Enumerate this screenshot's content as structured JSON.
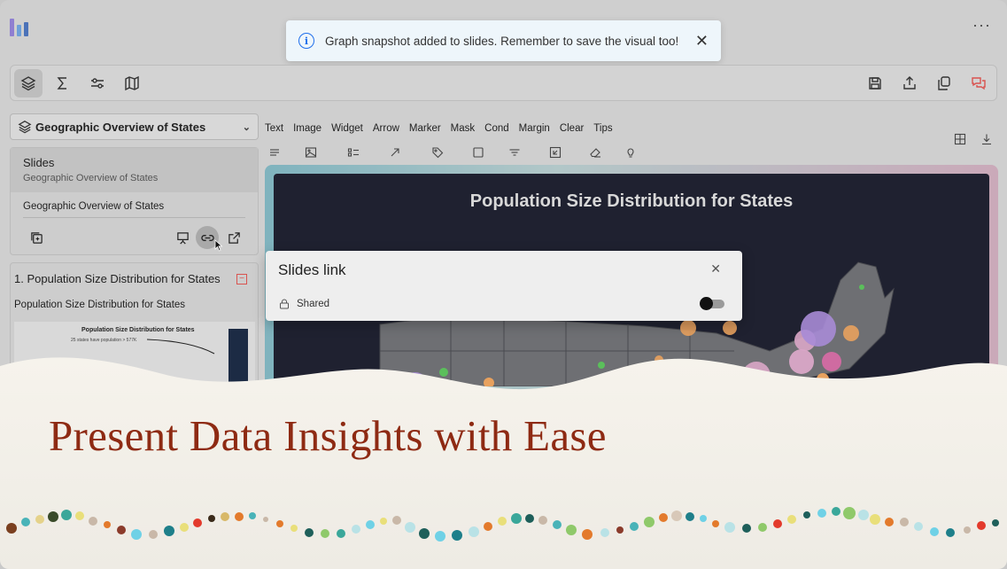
{
  "toast": {
    "message": "Graph snapshot added to slides. Remember to save the visual too!",
    "close": "✕"
  },
  "topbar": {
    "more": "···"
  },
  "sidebar": {
    "dropdown_label": "Geographic Overview of States",
    "slides_card": {
      "title": "Slides",
      "subtitle": "Geographic Overview of States",
      "item": "Geographic Overview of States"
    },
    "chart_card": {
      "title": "1.  Population Size Distribution for States",
      "subtitle": "Population Size Distribution for States",
      "thumb_title": "Population Size Distribution for States",
      "thumb_subtitle": "25 states have population > 577K"
    }
  },
  "palette": {
    "labels": [
      "Text",
      "Image",
      "Widget",
      "Arrow",
      "Marker",
      "Mask",
      "Cond",
      "Margin",
      "Clear",
      "Tips"
    ]
  },
  "canvas": {
    "title": "Population Size Distribution for States"
  },
  "modal": {
    "title": "Slides link",
    "close": "✕",
    "share_label": "Shared"
  },
  "overlay": {
    "headline": "Present Data Insights with Ease"
  },
  "colors": {
    "accent": "#1f6feb",
    "headline": "#8e2a13",
    "map_bg": "#1f2130",
    "alert_icon": "#d9534f"
  }
}
